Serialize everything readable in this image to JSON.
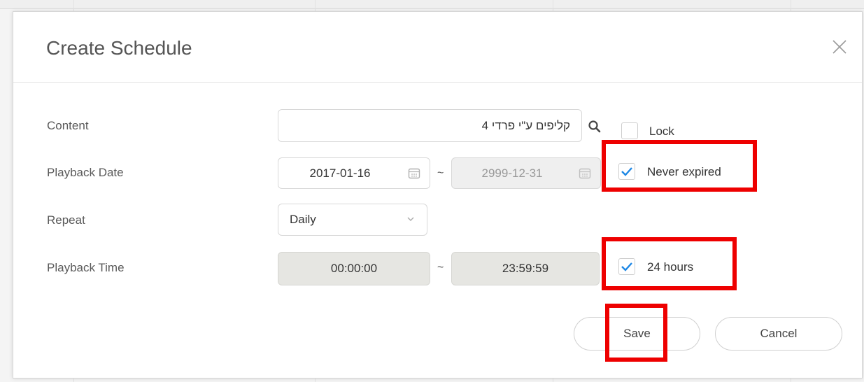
{
  "dialog": {
    "title": "Create Schedule"
  },
  "form": {
    "content": {
      "label": "Content",
      "value": "קליפים ע\"י פרדי 4",
      "lock_label": "Lock",
      "lock_checked": false
    },
    "playback_date": {
      "label": "Playback Date",
      "start": "2017-01-16",
      "separator": "~",
      "end": "2999-12-31",
      "never_expired_label": "Never expired",
      "never_expired_checked": true
    },
    "repeat": {
      "label": "Repeat",
      "value": "Daily"
    },
    "playback_time": {
      "label": "Playback Time",
      "start": "00:00:00",
      "separator": "~",
      "end": "23:59:59",
      "all_day_label": "24 hours",
      "all_day_checked": true
    }
  },
  "buttons": {
    "save": "Save",
    "cancel": "Cancel"
  },
  "icons": {
    "close": "close-icon",
    "search": "search-icon",
    "calendar": "calendar-icon",
    "chevron": "chevron-down-icon",
    "check": "checkmark-icon"
  },
  "colors": {
    "highlight": "#ee0000",
    "checkmark": "#1e88e5"
  }
}
